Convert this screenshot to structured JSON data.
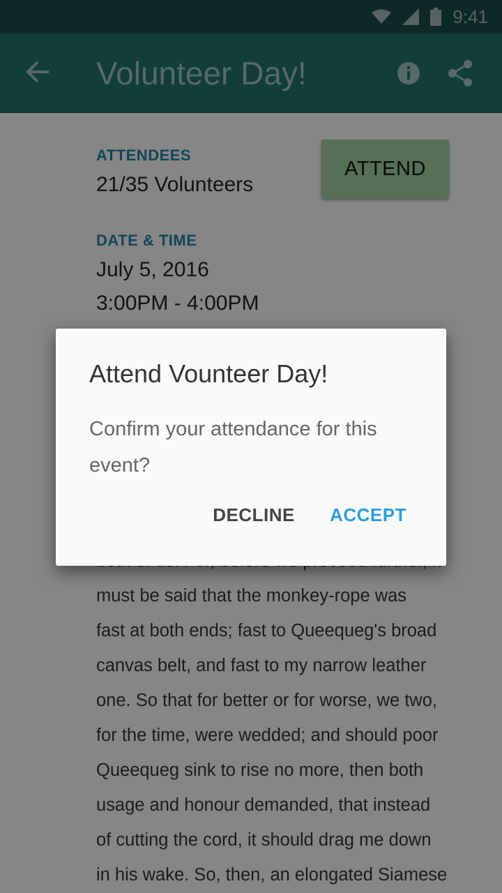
{
  "status_bar": {
    "time": "9:41",
    "icons": [
      "wifi-icon",
      "cell-signal-icon",
      "battery-icon"
    ]
  },
  "app_bar": {
    "title": "Volunteer Day!",
    "icons": [
      "back-arrow-icon",
      "info-icon",
      "share-icon"
    ]
  },
  "event": {
    "attendees_label": "ATTENDEES",
    "attendees_value": "21/35 Volunteers",
    "attend_button": "ATTEND",
    "datetime_label": "DATE & TIME",
    "date": "July 5, 2016",
    "time": "3:00PM - 4:00PM",
    "description_lines": [
      "both of us. For, before we proceed further, it",
      "must be said that the monkey-rope was",
      "fast at both ends; fast to Queequeg's broad",
      "canvas belt, and fast to my narrow leather",
      "one. So that for better or for worse, we two,",
      "for the time, were wedded; and should poor",
      "Queequeg sink to rise no more, then both",
      "usage and honour demanded, that instead",
      "of cutting the cord, it should drag me down",
      "in his wake. So, then, an elongated Siamese"
    ]
  },
  "dialog": {
    "title": "Attend Vounteer Day!",
    "message_lines": [
      "Confirm your attendance for this",
      "event?"
    ],
    "decline_label": "DECLINE",
    "accept_label": "ACCEPT"
  },
  "colors": {
    "status_bar": "#1a4a4a",
    "app_bar": "#1f6f6a",
    "section_label": "#1f7fa0",
    "attend_button": "#9ccc9c",
    "accept_text": "#2a9de0"
  }
}
